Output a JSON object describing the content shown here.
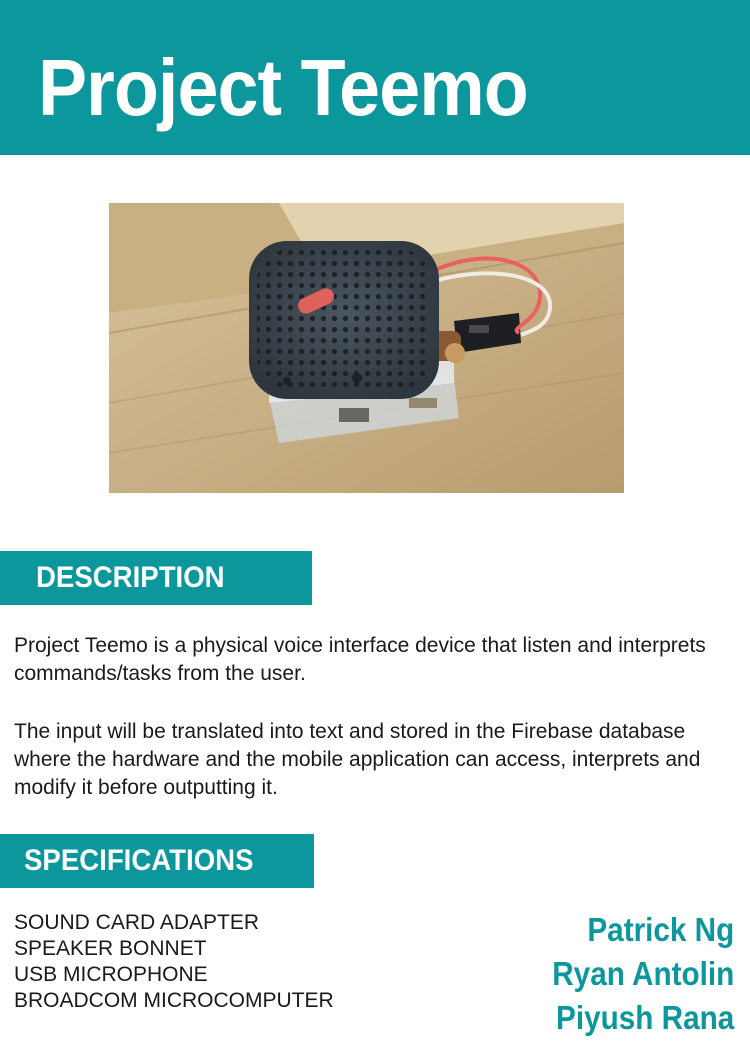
{
  "header": {
    "title": "Project Teemo"
  },
  "colors": {
    "accent": "#0b979c",
    "text": "#1a1a1a",
    "background": "#ffffff"
  },
  "photo": {
    "subject": "speaker-device-photo"
  },
  "description": {
    "heading": "DESCRIPTION",
    "paragraphs": [
      "Project Teemo is a physical voice interface device that listen and interprets commands/tasks from the user.",
      "The input will be translated into text and stored in the Firebase database where the hardware and the mobile application can access, interprets and modify it before outputting it."
    ]
  },
  "specifications": {
    "heading": "SPECIFICATIONS",
    "items": [
      "SOUND CARD ADAPTER",
      "SPEAKER BONNET",
      "USB MICROPHONE",
      "BROADCOM MICROCOMPUTER"
    ]
  },
  "team": {
    "members": [
      "Patrick Ng",
      "Ryan Antolin",
      "Piyush Rana"
    ]
  }
}
